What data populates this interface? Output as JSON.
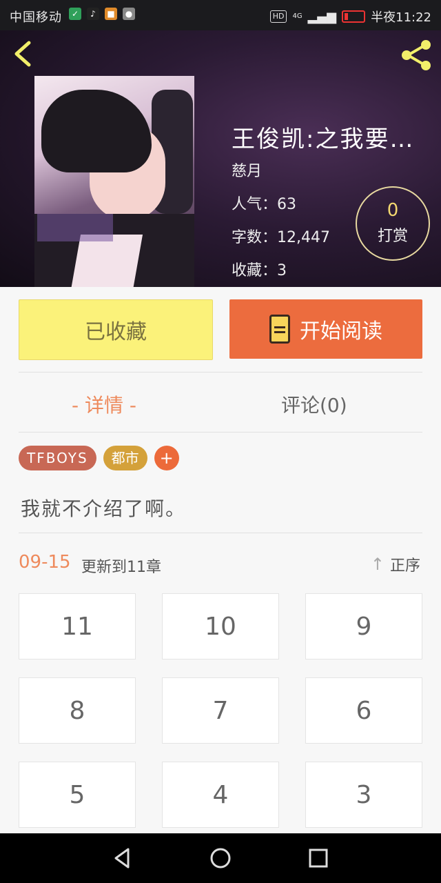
{
  "status_bar": {
    "carrier": "中国移动",
    "network": "4G",
    "hd": "HD",
    "time": "半夜11:22"
  },
  "book": {
    "title": "王俊凯:之我要…",
    "author": "慈月",
    "popularity_label": "人气：",
    "popularity": "63",
    "word_count_label": "字数：",
    "word_count": "12,447",
    "favorites_label": "收藏：",
    "favorites": "3",
    "reward_count": "0",
    "reward_label": "打赏"
  },
  "actions": {
    "collected_label": "已收藏",
    "read_label": "开始阅读"
  },
  "tabs": {
    "details": "- 详情 -",
    "comments": "评论(0)"
  },
  "tags": [
    "TFBOYS",
    "都市",
    "+"
  ],
  "description": "我就不介绍了啊。",
  "update": {
    "date": "09-15",
    "text": "更新到11章",
    "sort_label": "正序"
  },
  "chapters": [
    "11",
    "10",
    "9",
    "8",
    "7",
    "6",
    "5",
    "4",
    "3"
  ],
  "icons": {
    "back": "back-chevron-icon",
    "share": "share-icon",
    "book": "book-icon",
    "sort": "arrow-up-icon"
  },
  "colors": {
    "accent_orange": "#ec6c3e",
    "collected_yellow": "#fbf27a",
    "tag_tfboys": "#c86855",
    "tag_city": "#d4a13a"
  }
}
